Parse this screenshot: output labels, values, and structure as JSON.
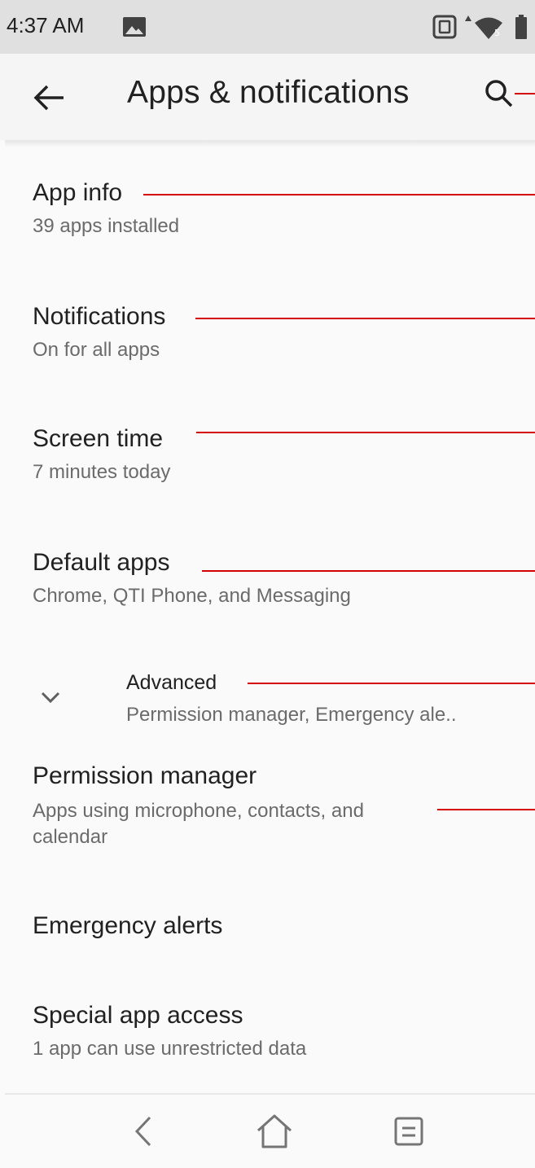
{
  "status_bar": {
    "time": "4:37 AM",
    "icons": [
      "image-icon",
      "nfc-icon",
      "data-arrow-icon",
      "wifi-icon",
      "battery-icon"
    ],
    "wifi_badge": "5"
  },
  "toolbar": {
    "title": "Apps & notifications",
    "back_icon": "arrow-back-icon",
    "search_icon": "search-icon"
  },
  "items": [
    {
      "title": "App info",
      "subtitle": "39 apps installed"
    },
    {
      "title": "Notifications",
      "subtitle": "On for all apps"
    },
    {
      "title": "Screen time",
      "subtitle": "7 minutes today"
    },
    {
      "title": "Default apps",
      "subtitle": "Chrome, QTI Phone, and Messaging"
    }
  ],
  "advanced": {
    "title": "Advanced",
    "subtitle": "Permission manager, Emergency ale..",
    "icon": "chevron-down-icon"
  },
  "permission_manager": {
    "title": "Permission manager",
    "subtitle_line1": "Apps using microphone, contacts, and",
    "subtitle_line2": "calendar"
  },
  "emergency_alerts": {
    "title": "Emergency alerts"
  },
  "special_app_access": {
    "title": "Special app access",
    "subtitle": "1 app can use unrestricted data"
  },
  "nav_bar": {
    "icons": [
      "nav-back-icon",
      "nav-home-icon",
      "nav-recents-icon"
    ]
  },
  "colors": {
    "annotation_line": "#d50000",
    "status_bar_bg": "#e0e0e0",
    "toolbar_bg": "#f5f5f5",
    "list_bg": "#fafafa",
    "primary_text": "#212121",
    "secondary_text": "#6b6b6b"
  }
}
